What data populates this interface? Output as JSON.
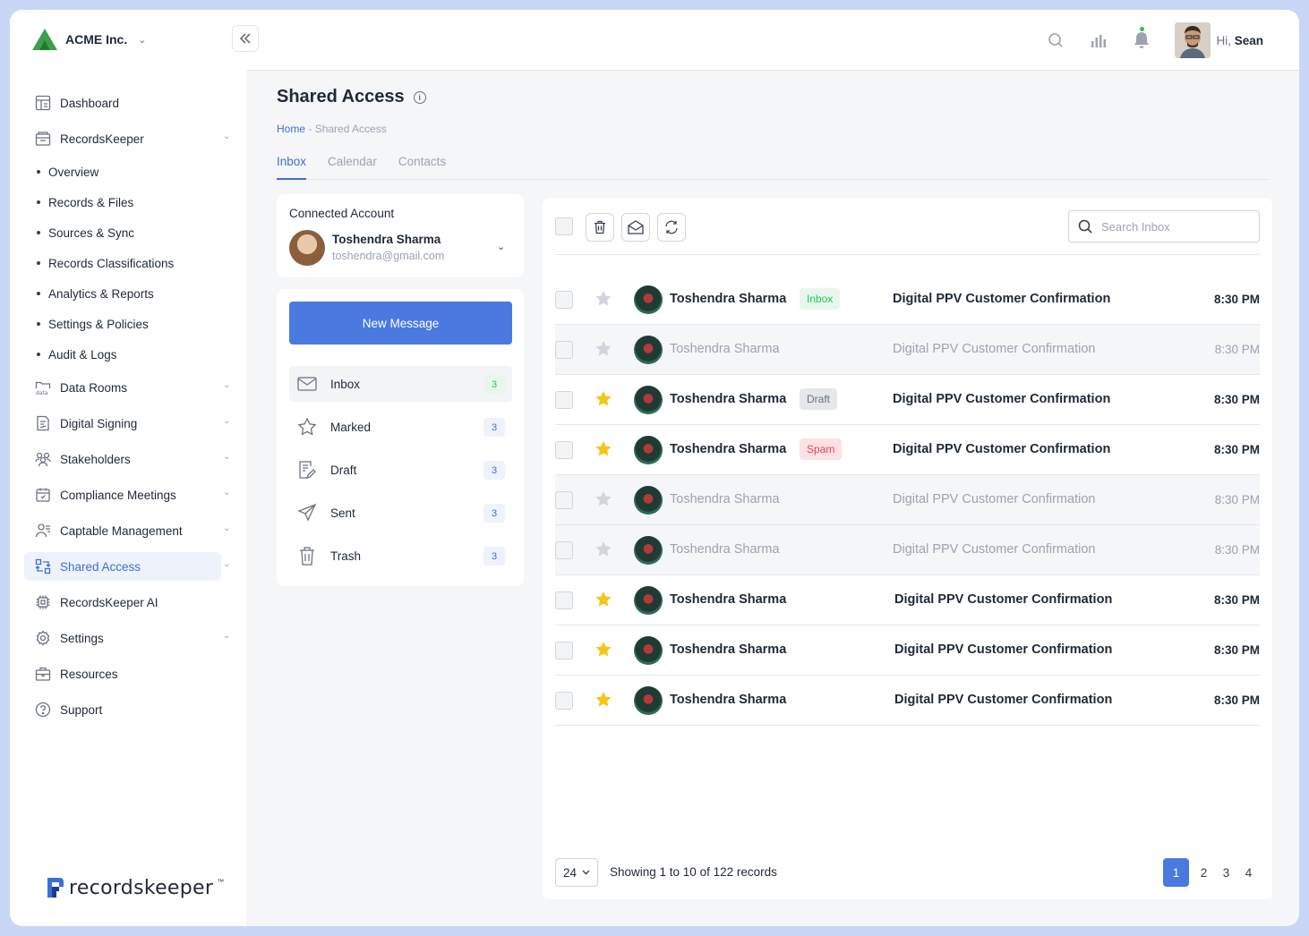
{
  "brand": {
    "name": "ACME Inc."
  },
  "sidebar": {
    "items": [
      {
        "label": "Dashboard",
        "icon": "dashboard-icon"
      },
      {
        "label": "RecordsKeeper",
        "icon": "records-icon",
        "expandable": true
      },
      {
        "label": "Data Rooms",
        "icon": "data-rooms-icon",
        "expandable": true
      },
      {
        "label": "Digital Signing",
        "icon": "signing-icon",
        "expandable": true
      },
      {
        "label": "Stakeholders",
        "icon": "stakeholders-icon",
        "expandable": true
      },
      {
        "label": "Compliance Meetings",
        "icon": "meetings-icon",
        "expandable": true
      },
      {
        "label": "Captable Management",
        "icon": "captable-icon",
        "expandable": true
      },
      {
        "label": "Shared Access",
        "icon": "shared-access-icon",
        "expandable": true,
        "active": true
      },
      {
        "label": "RecordsKeeper AI",
        "icon": "ai-chip-icon"
      },
      {
        "label": "Settings",
        "icon": "gear-icon",
        "expandable": true
      },
      {
        "label": "Resources",
        "icon": "briefcase-icon"
      },
      {
        "label": "Support",
        "icon": "help-icon"
      }
    ],
    "subitems": [
      "Overview",
      "Records & Files",
      "Sources & Sync",
      "Records Classifications",
      "Analytics & Reports",
      "Settings & Policies",
      "Audit & Logs"
    ],
    "footer_logo": "recordskeeper",
    "footer_tm": "™"
  },
  "header": {
    "greeting": "Hi,",
    "user_name": "Sean"
  },
  "page": {
    "title": "Shared Access",
    "breadcrumb_home": "Home",
    "breadcrumb_sep": " - ",
    "breadcrumb_current": "Shared Access",
    "tabs": [
      "Inbox",
      "Calendar",
      "Contacts"
    ]
  },
  "account": {
    "label": "Connected Account",
    "name": "Toshendra Sharma",
    "email": "toshendra@gmail.com"
  },
  "folders": {
    "new_message": "New Message",
    "items": [
      {
        "label": "Inbox",
        "count": "3",
        "icon": "mail-icon"
      },
      {
        "label": "Marked",
        "count": "3",
        "icon": "star-icon"
      },
      {
        "label": "Draft",
        "count": "3",
        "icon": "draft-icon"
      },
      {
        "label": "Sent",
        "count": "3",
        "icon": "send-icon"
      },
      {
        "label": "Trash",
        "count": "3",
        "icon": "trash-icon"
      }
    ]
  },
  "mail": {
    "search_placeholder": "Search Inbox",
    "rows": [
      {
        "sender": "Toshendra Sharma",
        "badge": "Inbox",
        "subject": "Digital PPV Customer Confirmation",
        "time": "8:30 PM",
        "starred": false,
        "read": false
      },
      {
        "sender": "Toshendra Sharma",
        "badge": "",
        "subject": "Digital PPV Customer Confirmation",
        "time": "8:30 PM",
        "starred": false,
        "read": true
      },
      {
        "sender": "Toshendra Sharma",
        "badge": "Draft",
        "subject": "Digital PPV Customer Confirmation",
        "time": "8:30 PM",
        "starred": true,
        "read": false
      },
      {
        "sender": "Toshendra Sharma",
        "badge": "Spam",
        "subject": "Digital PPV Customer Confirmation",
        "time": "8:30 PM",
        "starred": true,
        "read": false
      },
      {
        "sender": "Toshendra Sharma",
        "badge": "",
        "subject": "Digital PPV Customer Confirmation",
        "time": "8:30 PM",
        "starred": false,
        "read": true
      },
      {
        "sender": "Toshendra Sharma",
        "badge": "",
        "subject": "Digital PPV Customer Confirmation",
        "time": "8:30 PM",
        "starred": false,
        "read": true
      },
      {
        "sender": "Toshendra Sharma",
        "badge": "",
        "subject": "Digital PPV Customer Confirmation",
        "time": "8:30 PM",
        "starred": true,
        "read": false
      },
      {
        "sender": "Toshendra Sharma",
        "badge": "",
        "subject": "Digital PPV Customer Confirmation",
        "time": "8:30 PM",
        "starred": true,
        "read": false
      },
      {
        "sender": "Toshendra Sharma",
        "badge": "",
        "subject": "Digital PPV Customer Confirmation",
        "time": "8:30 PM",
        "starred": true,
        "read": false
      }
    ]
  },
  "pagination": {
    "page_size": "24",
    "info": "Showing 1 to 10 of 122 records",
    "pages": [
      "1",
      "2",
      "3",
      "4"
    ],
    "current": "1",
    "first": "«",
    "prev": "‹",
    "next": "›",
    "last": "»"
  },
  "colors": {
    "accent": "#4a7ae0",
    "star": "#f5c518",
    "inbox_badge": "#22c55e",
    "spam_badge": "#e0455a"
  }
}
